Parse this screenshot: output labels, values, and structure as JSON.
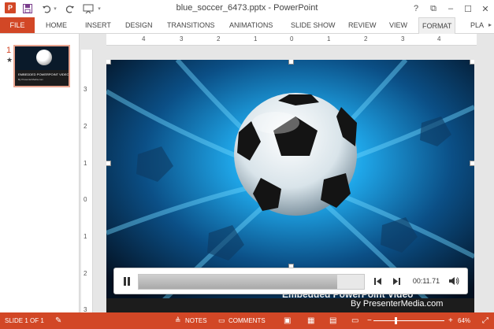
{
  "title_bar": {
    "app_icon": "P",
    "window_title": "blue_soccer_6473.pptx - PowerPoint",
    "icons": [
      "powerpoint-icon",
      "save-icon",
      "undo-icon",
      "redo-icon",
      "start-slideshow-icon"
    ],
    "controls": [
      "?",
      "restore",
      "minimize",
      "maximize",
      "close"
    ]
  },
  "ribbon": {
    "file_tab": "FILE",
    "tabs": [
      "HOME",
      "INSERT",
      "DESIGN",
      "TRANSITIONS",
      "ANIMATIONS",
      "SLIDE SHOW",
      "REVIEW",
      "VIEW",
      "FORMAT",
      "PLA"
    ],
    "active_tab": "FORMAT"
  },
  "thumbnails": {
    "slide_number": "1",
    "animation_marker": "★",
    "thumb_title": "EMBEDDED POWERPOINT VIDEO",
    "thumb_subtitle": "By PresenterMedia.com"
  },
  "rulers": {
    "horizontal": [
      "4",
      "3",
      "2",
      "1",
      "0",
      "1",
      "2",
      "3",
      "4"
    ],
    "vertical": [
      "3",
      "2",
      "1",
      "0",
      "1",
      "2",
      "3"
    ]
  },
  "slide": {
    "title": "Embedded PowerPoint Video",
    "subtitle": "By PresenterMedia.com",
    "accent_color": "#1fa6e8"
  },
  "media_controls": {
    "play_state": "playing",
    "progress": 0.88,
    "time": "00:11.71",
    "icons": [
      "pause-icon",
      "step-back-icon",
      "step-forward-icon",
      "volume-icon"
    ]
  },
  "status_bar": {
    "slide_info": "SLIDE 1 OF 1",
    "notes_label": "NOTES",
    "comments_label": "COMMENTS",
    "zoom_minus": "−",
    "zoom_plus": "+",
    "zoom_level": "64%",
    "zoom_fraction": 0.3,
    "color": "#d24726"
  }
}
